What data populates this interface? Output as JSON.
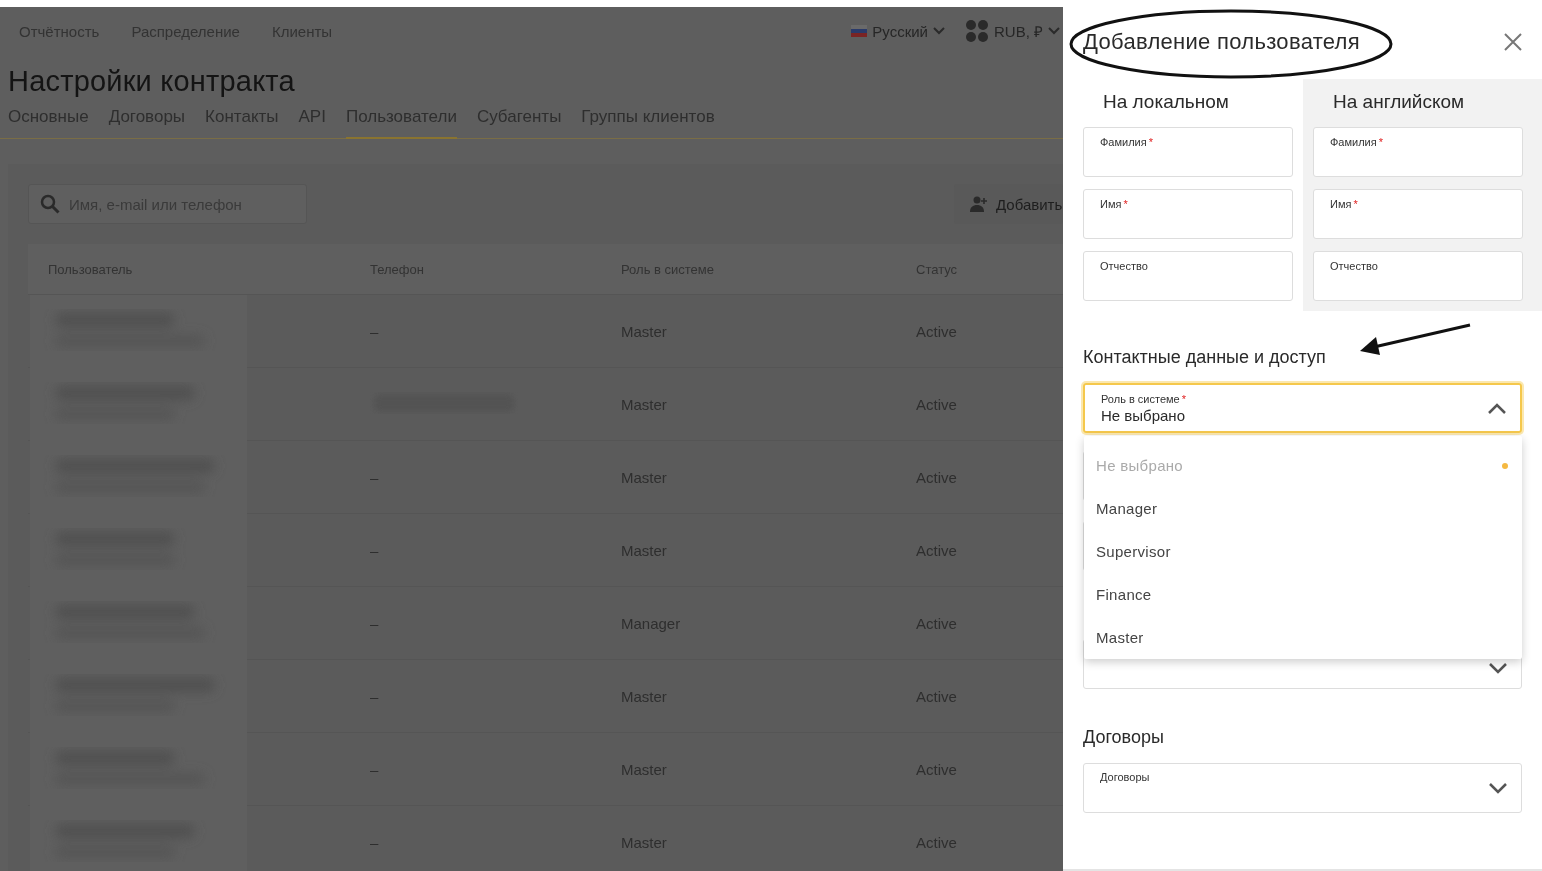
{
  "top_nav": {
    "links": [
      "Отчётность",
      "Распределение",
      "Клиенты"
    ],
    "language": {
      "label": "Русский"
    },
    "currency": {
      "label": "RUB, ₽"
    }
  },
  "page_title": "Настройки контракта",
  "tabs": [
    {
      "label": "Основные",
      "selected": false
    },
    {
      "label": "Договоры",
      "selected": false
    },
    {
      "label": "Контакты",
      "selected": false
    },
    {
      "label": "API",
      "selected": false
    },
    {
      "label": "Пользователи",
      "selected": true
    },
    {
      "label": "Субагенты",
      "selected": false
    },
    {
      "label": "Группы клиентов",
      "selected": false
    }
  ],
  "search": {
    "placeholder": "Имя, e-mail или телефон"
  },
  "add_button": {
    "label": "Добавить"
  },
  "table": {
    "columns": [
      "Пользователь",
      "Телефон",
      "Роль в системе",
      "Статус"
    ],
    "rows": [
      {
        "phone": "–",
        "phone_hidden": false,
        "role": "Master",
        "status": "Active"
      },
      {
        "phone": "",
        "phone_hidden": true,
        "role": "Master",
        "status": "Active"
      },
      {
        "phone": "–",
        "phone_hidden": false,
        "role": "Master",
        "status": "Active"
      },
      {
        "phone": "–",
        "phone_hidden": false,
        "role": "Master",
        "status": "Active"
      },
      {
        "phone": "–",
        "phone_hidden": false,
        "role": "Manager",
        "status": "Active"
      },
      {
        "phone": "–",
        "phone_hidden": false,
        "role": "Master",
        "status": "Active"
      },
      {
        "phone": "–",
        "phone_hidden": false,
        "role": "Master",
        "status": "Active"
      },
      {
        "phone": "–",
        "phone_hidden": false,
        "role": "Master",
        "status": "Active"
      }
    ]
  },
  "panel": {
    "title": "Добавление пользователя",
    "columns": [
      {
        "heading": "На локальном",
        "shaded": false,
        "fields": [
          {
            "label": "Фамилия",
            "required_mark": "*"
          },
          {
            "label": "Имя",
            "required_mark": "*"
          },
          {
            "label": "Отчество"
          }
        ]
      },
      {
        "heading": "На английском",
        "shaded": true,
        "fields": [
          {
            "label": "Фамилия",
            "required_mark": "*"
          },
          {
            "label": "Имя",
            "required_mark": "*"
          },
          {
            "label": "Отчество"
          }
        ]
      }
    ],
    "contact_section": {
      "heading": "Контактные данные и доступ",
      "role_select": {
        "label": "Роль в системе",
        "required_mark": "*",
        "value": "Не выбрано",
        "open": true,
        "options": [
          {
            "label": "Не выбрано",
            "selected": true
          },
          {
            "label": "Manager",
            "selected": false
          },
          {
            "label": "Supervisor",
            "selected": false
          },
          {
            "label": "Finance",
            "selected": false
          },
          {
            "label": "Master",
            "selected": false
          }
        ]
      }
    },
    "contracts_section": {
      "heading": "Договоры",
      "select": {
        "label": "Договоры"
      }
    }
  }
}
